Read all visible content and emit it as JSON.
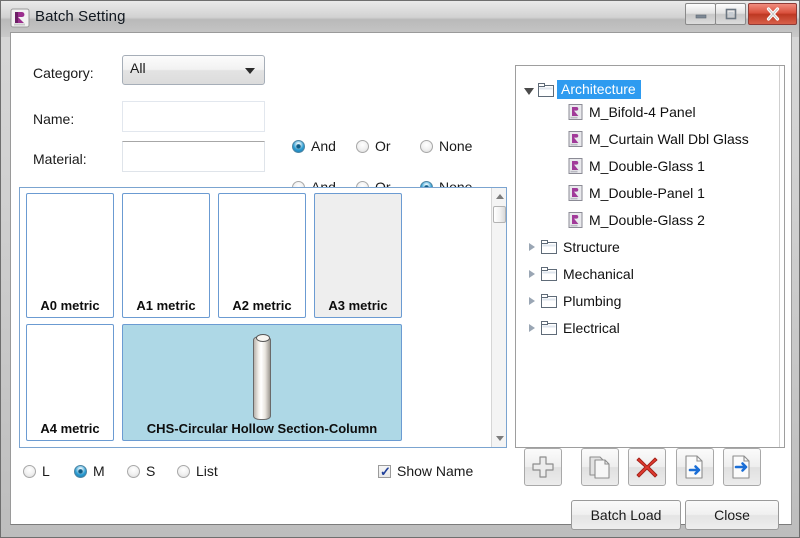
{
  "window": {
    "title": "Batch Setting",
    "icon": "revit-family-icon",
    "controls": {
      "minimize": "minimize-icon",
      "maximize": "maximize-icon",
      "close": "close-icon"
    }
  },
  "filters": {
    "category": {
      "label": "Category:",
      "value": "All",
      "options": [
        "All"
      ]
    },
    "name": {
      "label": "Name:",
      "value": "",
      "placeholder": "",
      "operators": [
        {
          "label": "And",
          "selected": true
        },
        {
          "label": "Or",
          "selected": false
        },
        {
          "label": "None",
          "selected": false
        }
      ]
    },
    "material": {
      "label": "Material:",
      "value": "",
      "placeholder": "",
      "operators": [
        {
          "label": "And",
          "selected": false
        },
        {
          "label": "Or",
          "selected": false
        },
        {
          "label": "None",
          "selected": true
        }
      ]
    }
  },
  "thumbnails": {
    "items": [
      {
        "caption": "A0 metric",
        "state": "normal",
        "preview": "none"
      },
      {
        "caption": "A1 metric",
        "state": "normal",
        "preview": "none"
      },
      {
        "caption": "A2 metric",
        "state": "normal",
        "preview": "none"
      },
      {
        "caption": "A3 metric",
        "state": "hover",
        "preview": "none"
      },
      {
        "caption": "A4 metric",
        "state": "normal",
        "preview": "none"
      },
      {
        "caption": "CHS-Circular Hollow Section-Column",
        "state": "selected",
        "preview": "column-cylinder"
      }
    ]
  },
  "view_options": {
    "sizes": [
      {
        "label": "L",
        "selected": false
      },
      {
        "label": "M",
        "selected": true
      },
      {
        "label": "S",
        "selected": false
      },
      {
        "label": "List",
        "selected": false
      }
    ],
    "show_name": {
      "label": "Show Name",
      "checked": true
    }
  },
  "tree": {
    "nodes": [
      {
        "label": "Architecture",
        "type": "folder",
        "depth": 0,
        "expanded": true,
        "selected": true
      },
      {
        "label": "M_Bifold-4 Panel",
        "type": "family",
        "depth": 1,
        "expanded": null,
        "selected": false
      },
      {
        "label": "M_Curtain Wall Dbl Glass",
        "type": "family",
        "depth": 1,
        "expanded": null,
        "selected": false
      },
      {
        "label": "M_Double-Glass 1",
        "type": "family",
        "depth": 1,
        "expanded": null,
        "selected": false
      },
      {
        "label": "M_Double-Panel 1",
        "type": "family",
        "depth": 1,
        "expanded": null,
        "selected": false
      },
      {
        "label": "M_Double-Glass 2",
        "type": "family",
        "depth": 1,
        "expanded": null,
        "selected": false
      },
      {
        "label": "Structure",
        "type": "folder",
        "depth": 0,
        "expanded": false,
        "selected": false
      },
      {
        "label": "Mechanical",
        "type": "folder",
        "depth": 0,
        "expanded": false,
        "selected": false
      },
      {
        "label": "Plumbing",
        "type": "folder",
        "depth": 0,
        "expanded": false,
        "selected": false
      },
      {
        "label": "Electrical",
        "type": "folder",
        "depth": 0,
        "expanded": false,
        "selected": false
      }
    ]
  },
  "toolbar": {
    "buttons": [
      {
        "name": "add-icon",
        "title": ""
      },
      {
        "name": "copy-icon",
        "title": ""
      },
      {
        "name": "delete-icon",
        "title": ""
      },
      {
        "name": "export-icon",
        "title": ""
      },
      {
        "name": "export-all-icon",
        "title": ""
      }
    ]
  },
  "actions": {
    "batch_load": "Batch Load",
    "close": "Close"
  },
  "colors": {
    "selection_blue": "#2e9bf0",
    "thumb_selected": "#aed8e6",
    "thumb_border": "#6b9bd2",
    "accent_radio": "#1572a8",
    "close_red": "#d9503c",
    "check_blue": "#21409a"
  }
}
